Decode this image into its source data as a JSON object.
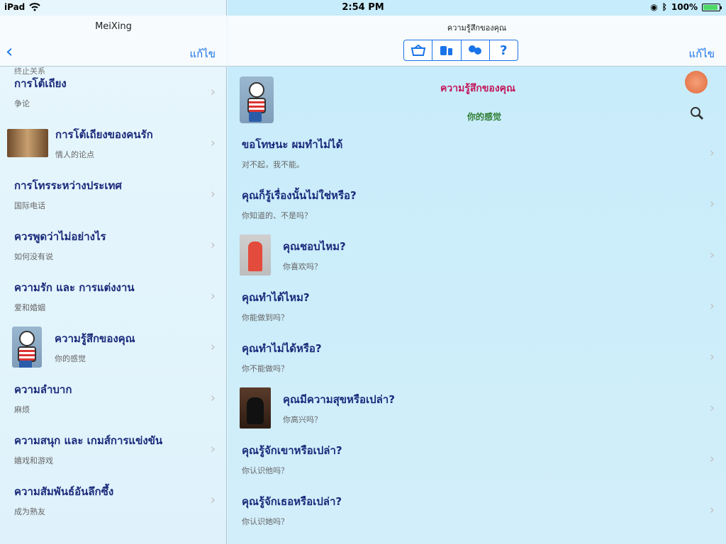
{
  "status": {
    "device": "iPad",
    "time": "2:54 PM",
    "battery": "100%",
    "battery_level": 1.0
  },
  "left": {
    "title": "MeiXing",
    "edit_label": "แก้ไข",
    "items": [
      {
        "th": "การโต้เถียง",
        "cn": "争论",
        "thumb": "none"
      },
      {
        "th": "การโต้เถียงของคนรัก",
        "cn": "情人的论点",
        "thumb": "couple-photo"
      },
      {
        "th": "การโทรระหว่างประเทศ",
        "cn": "国际电话",
        "thumb": "none"
      },
      {
        "th": "ควรพูดว่าไม่อย่างไร",
        "cn": "如何没有说",
        "thumb": "none"
      },
      {
        "th": "ความรัก และ การแต่งงาน",
        "cn": "爱和婚姻",
        "thumb": "none"
      },
      {
        "th": "ความรู้สึกของคุณ",
        "cn": "你的感觉",
        "thumb": "character"
      },
      {
        "th": "ความลำบาก",
        "cn": "麻烦",
        "thumb": "none"
      },
      {
        "th": "ความสนุก และ เกมส์การแข่งขัน",
        "cn": "嬉戏和游戏",
        "thumb": "none"
      },
      {
        "th": "ความสัมพันธ์อันลึกซึ้ง",
        "cn": "成为熟友",
        "thumb": "none"
      }
    ],
    "partial_top": "终止关系"
  },
  "right": {
    "title": "ความรู้สึกของคุณ",
    "edit_label": "แก้ไข",
    "segments": [
      "basket-icon",
      "dictionary-icon",
      "flowers-icon",
      "help-icon"
    ],
    "help_glyph": "?",
    "header_title": "ความรู้สึกของคุณ",
    "header_sub": "你的感觉",
    "items": [
      {
        "th": "ขอโทษนะ ผมทำไม่ได้",
        "cn": "对不起，我不能。",
        "thumb": "none"
      },
      {
        "th": "คุณก็รู้เรื่องนั้นไม่ใช่หรือ?",
        "cn": "你知道的、不是吗？",
        "thumb": "none"
      },
      {
        "th": "คุณชอบไหม?",
        "cn": "你喜欢吗？",
        "thumb": "woman-red-dress"
      },
      {
        "th": "คุณทำได้ไหม?",
        "cn": "你能做到吗？",
        "thumb": "none"
      },
      {
        "th": "คุณทำไม่ได้หรือ?",
        "cn": "你不能做吗？",
        "thumb": "none"
      },
      {
        "th": "คุณมีความสุขหรือเปล่า?",
        "cn": "你高兴吗？",
        "thumb": "woman-dark"
      },
      {
        "th": "คุณรู้จักเขาหรือเปล่า?",
        "cn": "你认识他吗？",
        "thumb": "none"
      },
      {
        "th": "คุณรู้จักเธอหรือเปล่า?",
        "cn": "你认识她吗？",
        "thumb": "none"
      }
    ]
  },
  "colors": {
    "accent": "#1a73e8",
    "thai_text": "#1a2a7a",
    "header_title": "#c2185b",
    "header_sub": "#2e7d32"
  }
}
